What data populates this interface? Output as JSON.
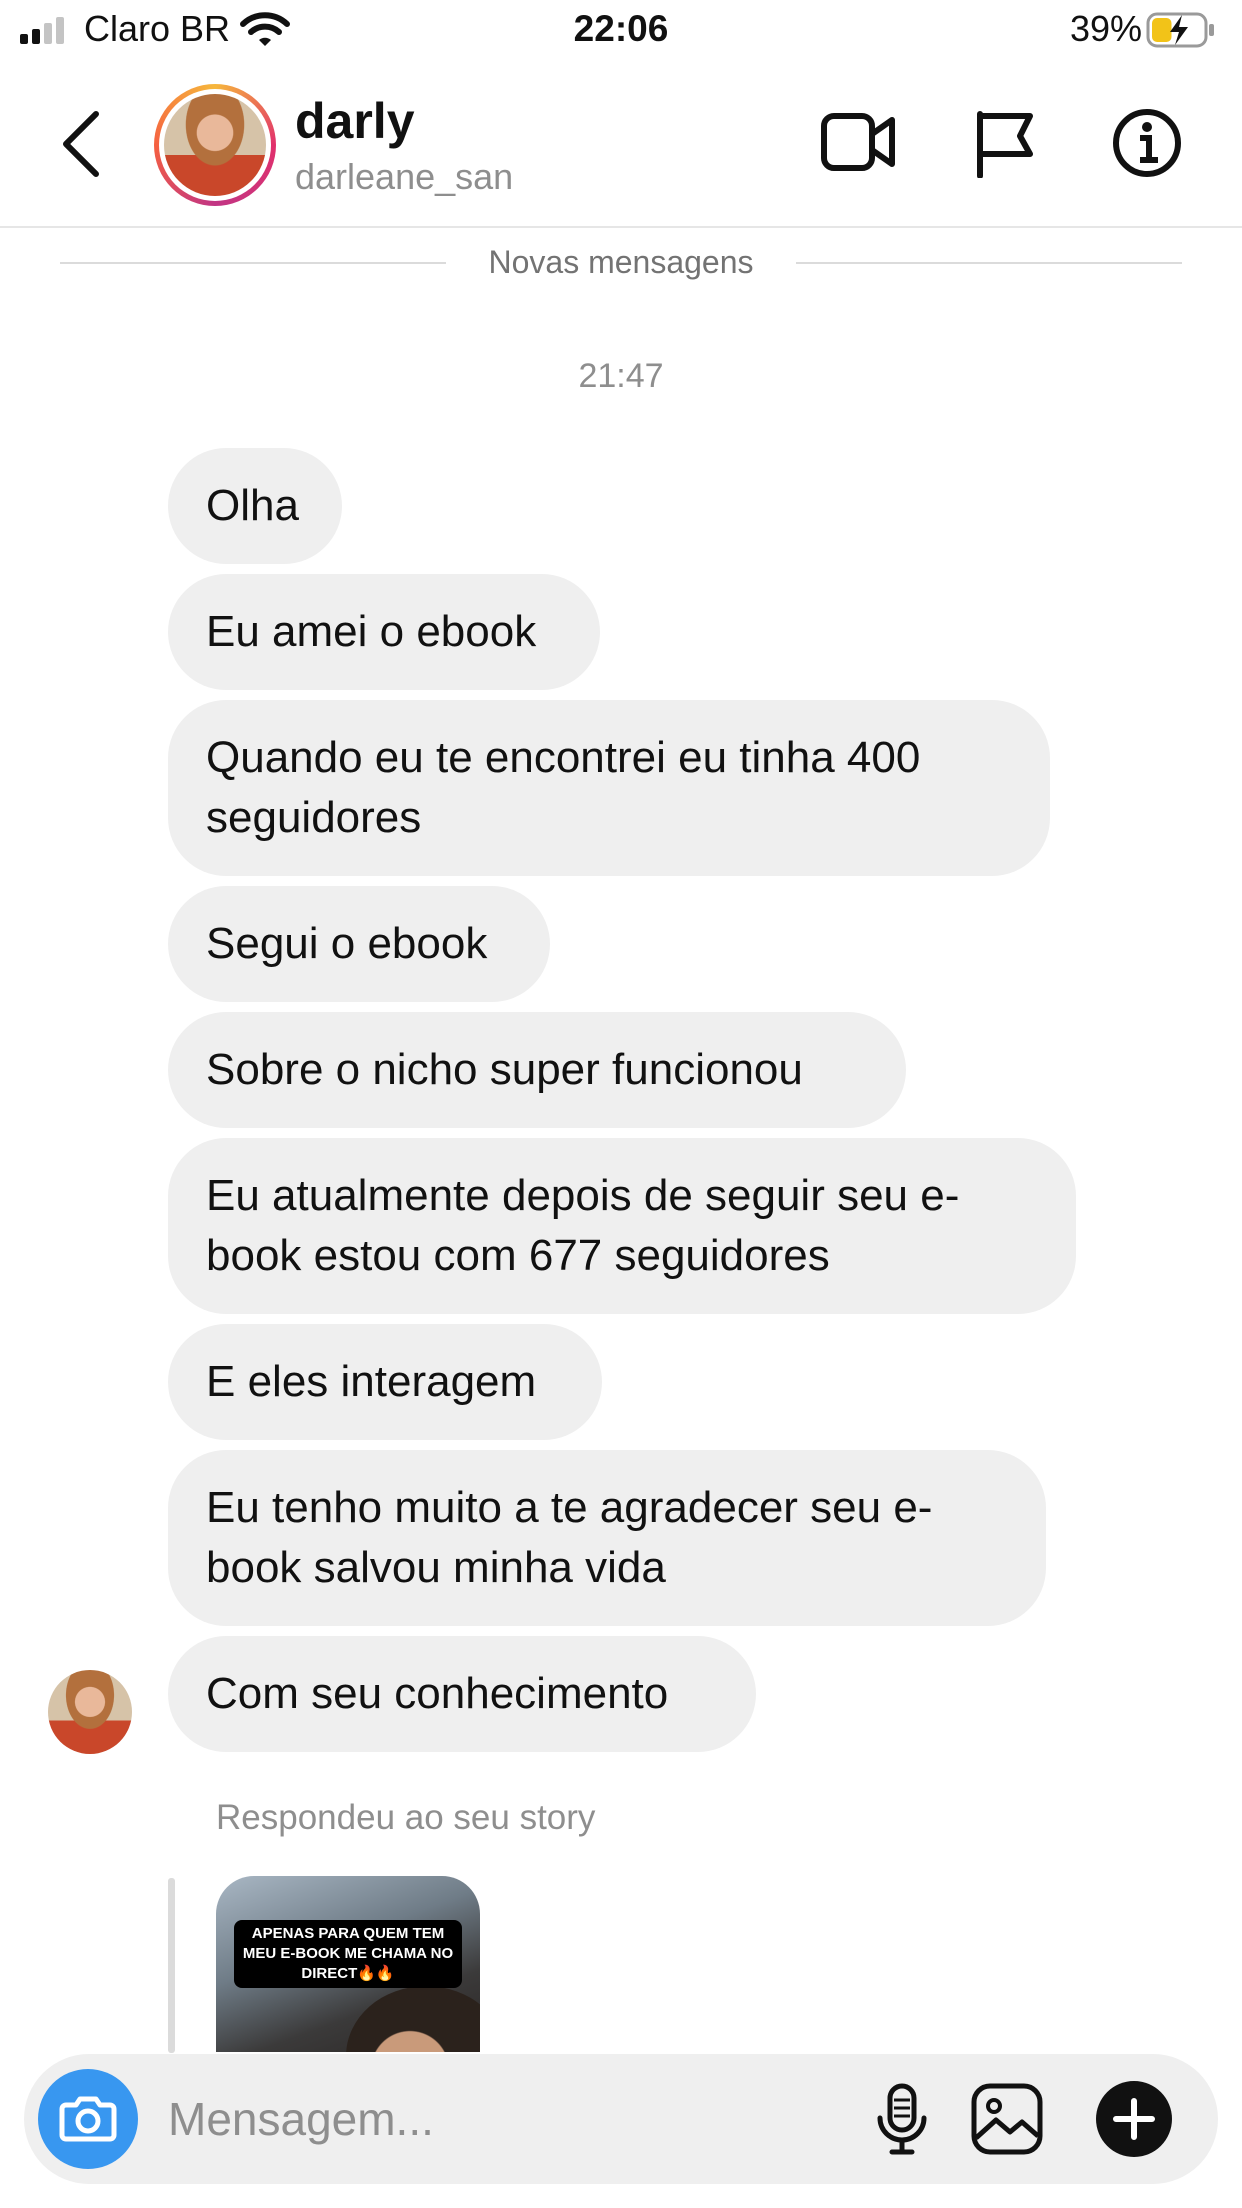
{
  "status_bar": {
    "carrier": "Claro BR",
    "time": "22:06",
    "battery_percent": "39%",
    "battery_level": 0.39,
    "charging": true
  },
  "header": {
    "display_name": "darly",
    "username": "darleane_san",
    "icons": [
      "back-chevron-icon",
      "video-call-icon",
      "flag-icon",
      "info-icon"
    ]
  },
  "chat": {
    "divider_label": "Novas mensagens",
    "timestamp": "21:47",
    "messages": [
      "Olha",
      "Eu amei o ebook",
      "Quando eu te encontrei eu tinha 400 seguidores",
      "Segui o ebook",
      "Sobre o nicho super funcionou",
      "Eu atualmente depois de seguir seu e-book estou com 677 seguidores",
      "E eles interagem",
      "Eu tenho muito a te agradecer seu e-book salvou minha vida",
      "Com seu conhecimento"
    ],
    "story_reply": {
      "label": "Respondeu ao seu story",
      "story_caption": "APENAS PARA QUEM TEM MEU E-BOOK ME CHAMA NO DIRECT🔥🔥"
    }
  },
  "composer": {
    "placeholder": "Mensagem...",
    "icons": [
      "camera-icon",
      "microphone-icon",
      "gallery-icon",
      "plus-icon"
    ]
  },
  "colors": {
    "bubble_bg": "#efefef",
    "camera_button": "#3897f0",
    "secondary_text": "#8e8e8e"
  }
}
